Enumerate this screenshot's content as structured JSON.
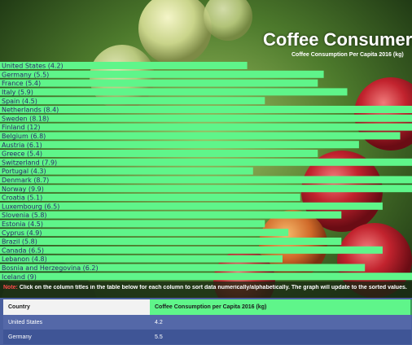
{
  "header": {
    "title": "Coffee Consumers",
    "subtitle": "Coffee Consumption Per Capita 2016 (kg)"
  },
  "colors": {
    "bar": "#5ff58a",
    "note_label": "#ff4b4b",
    "table_header_value": "#5ff58a",
    "table_row_a": "#5468a8",
    "table_row_b": "#3f5596"
  },
  "chart_data": {
    "type": "bar",
    "orientation": "horizontal",
    "title": "Coffee Consumers",
    "subtitle": "Coffee Consumption Per Capita 2016 (kg)",
    "categories": [
      "United States",
      "Germany",
      "France",
      "Italy",
      "Spain",
      "Netherlands",
      "Sweden",
      "Finland",
      "Belgium",
      "Austria",
      "Greece",
      "Switzerland",
      "Portugal",
      "Denmark",
      "Norway",
      "Croatia",
      "Luxembourg",
      "Slovenia",
      "Estonia",
      "Cyprus",
      "Brazil",
      "Canada",
      "Lebanon",
      "Bosnia and Herzegovina",
      "Iceland"
    ],
    "values": [
      4.2,
      5.5,
      5.4,
      5.9,
      4.5,
      8.4,
      8.18,
      12,
      6.8,
      6.1,
      5.4,
      7.9,
      4.3,
      8.7,
      9.9,
      5.1,
      6.5,
      5.8,
      4.5,
      4.9,
      5.8,
      6.5,
      4.8,
      6.2,
      9
    ],
    "labels": [
      "United States (4.2)",
      "Germany (5.5)",
      "France (5.4)",
      "Italy (5.9)",
      "Spain (4.5)",
      "Netherlands (8.4)",
      "Sweden (8.18)",
      "Finland (12)",
      "Belgium (6.8)",
      "Austria (6.1)",
      "Greece (5.4)",
      "Switzerland (7.9)",
      "Portugal (4.3)",
      "Denmark (8.7)",
      "Norway (9.9)",
      "Croatia (5.1)",
      "Luxembourg (6.5)",
      "Slovenia (5.8)",
      "Estonia (4.5)",
      "Cyprus (4.9)",
      "Brazil (5.8)",
      "Canada (6.5)",
      "Lebanon (4.8)",
      "Bosnia and Herzegovina (6.2)",
      "Iceland (9)"
    ],
    "xlim": [
      0,
      7
    ],
    "grid": false,
    "legend": "none"
  },
  "note": {
    "label": "Note:",
    "text": "Click on the column titles in the table below for each column to sort data numerically/alphabetically. The graph will update to the sorted values."
  },
  "table": {
    "headers": [
      "Country",
      "Coffee Consumption per Capita 2016 (kg)"
    ],
    "rows": [
      [
        "United States",
        "4.2"
      ],
      [
        "Germany",
        "5.5"
      ]
    ]
  }
}
